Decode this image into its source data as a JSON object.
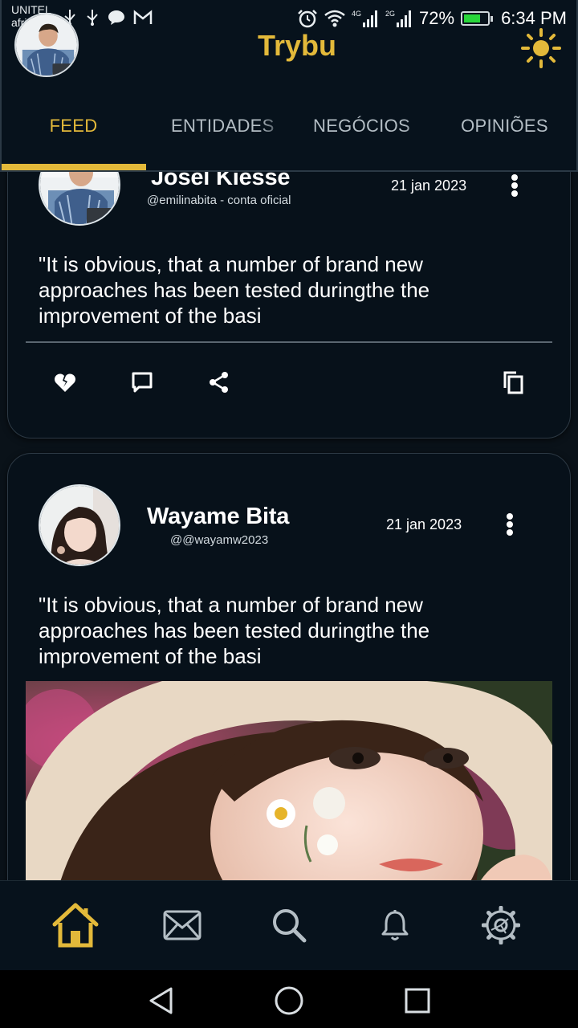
{
  "status_bar": {
    "carrier_line1": "UNITEL",
    "carrier_line2": "africell",
    "network_4g": "4G",
    "network_2g": "2G",
    "battery": "72%",
    "battery_level": 0.72,
    "time": "6:34 PM"
  },
  "header": {
    "title": "Trybu",
    "tabs": [
      {
        "label": "FEED",
        "active": true
      },
      {
        "label": "ENTIDADES",
        "active": false
      },
      {
        "label": "NEGÓCIOS",
        "active": false
      },
      {
        "label": "OPINIÕES",
        "active": false
      }
    ],
    "theme_icon": "sun-icon"
  },
  "posts": [
    {
      "author": "Josel Kiesse",
      "handle": "@emilinabita - conta oficial",
      "date": "21 jan 2023",
      "text": "\"It is obvious, that a number of brand new approaches has been tested duringthe the improvement of the basi",
      "actions": [
        "broken-heart-icon",
        "comment-icon",
        "share-icon",
        "copy-icon"
      ]
    },
    {
      "author": "Wayame Bita",
      "handle": "@@wayamw2023",
      "date": "21 jan 2023",
      "text": "\"It is obvious, that a number of brand new approaches has been tested duringthe the improvement of the basi",
      "has_image": true
    }
  ],
  "bottom_nav": {
    "items": [
      "home-icon",
      "mail-icon",
      "search-icon",
      "bell-icon",
      "settings-icon"
    ],
    "active": "home-icon"
  },
  "system_nav": [
    "back-icon",
    "home-circle-icon",
    "recents-icon"
  ],
  "colors": {
    "accent": "#e3b93a",
    "background": "#0a1219",
    "card": "#07111a",
    "text": "#ffffff",
    "muted": "#b4bec5"
  }
}
